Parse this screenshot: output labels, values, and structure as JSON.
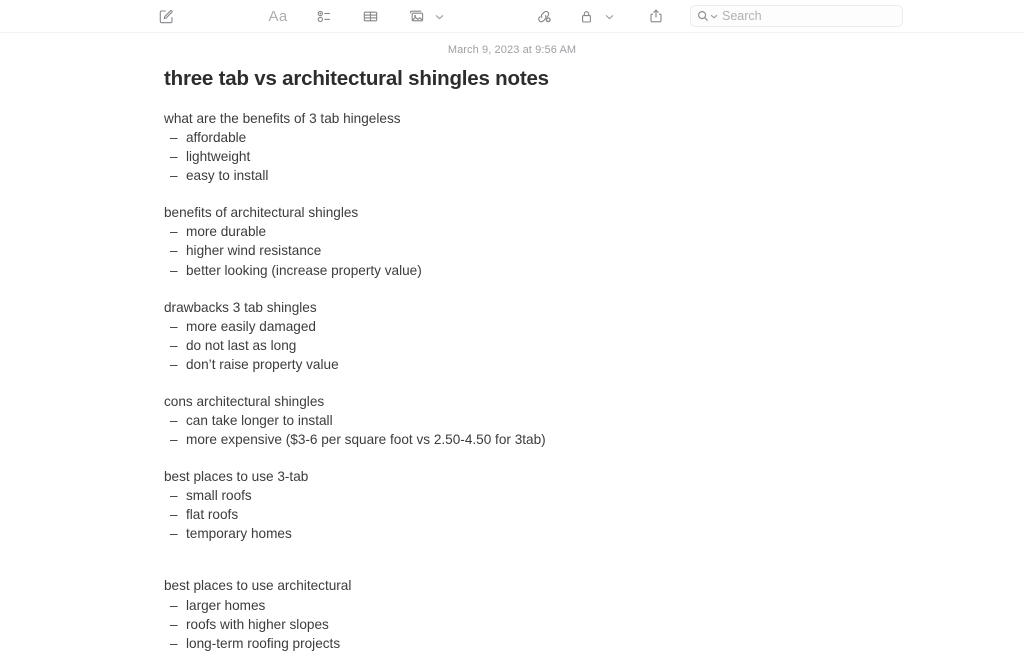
{
  "toolbar": {
    "compose": {
      "icon": "compose-icon",
      "label": "New Note"
    },
    "format": {
      "icon": "format-aa-icon",
      "label": "Aa"
    },
    "checklist": {
      "icon": "checklist-icon",
      "label": "Checklist"
    },
    "table": {
      "icon": "table-icon",
      "label": "Table"
    },
    "media": {
      "icon": "media-photo-icon",
      "label": "Media",
      "chevron": "⌄"
    },
    "link": {
      "icon": "add-link-icon",
      "label": "Add Link"
    },
    "lock": {
      "icon": "lock-icon",
      "label": "Lock Note",
      "chevron": "⌄"
    },
    "share": {
      "icon": "share-icon",
      "label": "Share"
    },
    "search": {
      "icon": "search-icon",
      "chevron": "⌄",
      "value": "",
      "placeholder": "Search"
    }
  },
  "note": {
    "date": "March 9, 2023 at 9:56 AM",
    "title": "three tab vs architectural shingles notes",
    "dash": "–",
    "sections": [
      {
        "heading": "what are the benefits of 3 tab hingeless",
        "items": [
          "affordable",
          "lightweight",
          "easy to install"
        ]
      },
      {
        "heading": "benefits of architectural shingles",
        "items": [
          "more durable",
          "higher wind resistance",
          "better looking (increase property value)"
        ]
      },
      {
        "heading": "drawbacks 3 tab shingles",
        "items": [
          "more easily damaged",
          "do not last as long",
          "don’t raise property value"
        ]
      },
      {
        "heading": "cons architectural shingles",
        "items": [
          "can take longer to install",
          "more expensive ($3-6 per square foot vs 2.50-4.50 for 3tab)"
        ]
      },
      {
        "heading": "best places to use 3-tab",
        "items": [
          "small roofs",
          "flat roofs",
          "temporary homes"
        ],
        "big_gap": true
      },
      {
        "heading": "best places to use architectural",
        "items": [
          "larger homes",
          "roofs with higher slopes",
          "long-term roofing projects"
        ]
      }
    ]
  },
  "colors": {
    "text": "#3c3c3e",
    "muted": "#a0a0a5",
    "icon": "#86868b",
    "background": "#ffffff"
  }
}
